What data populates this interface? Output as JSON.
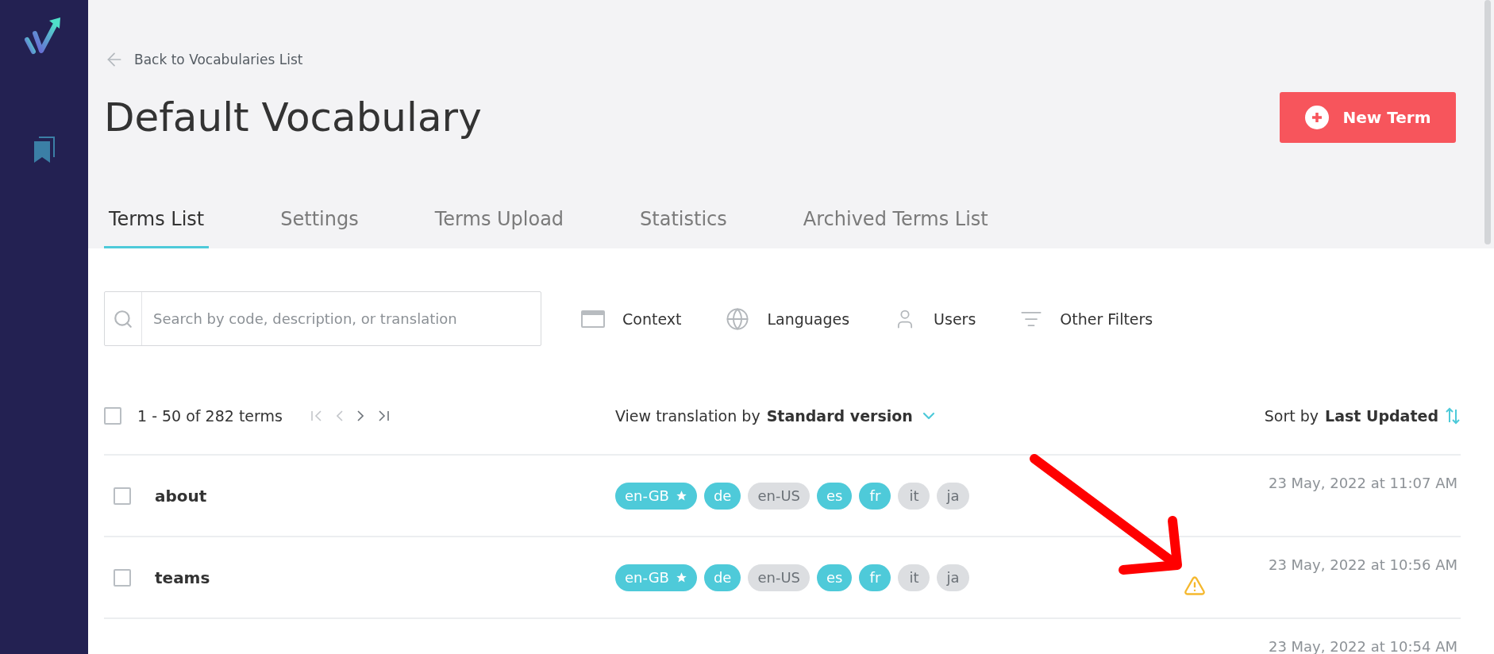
{
  "back_link": "Back to Vocabularies List",
  "title": "Default Vocabulary",
  "new_button": "New Term",
  "tabs": [
    {
      "label": "Terms List",
      "selected": true
    },
    {
      "label": "Settings",
      "selected": false
    },
    {
      "label": "Terms Upload",
      "selected": false
    },
    {
      "label": "Statistics",
      "selected": false
    },
    {
      "label": "Archived Terms List",
      "selected": false
    }
  ],
  "search": {
    "placeholder": "Search by code, description, or translation"
  },
  "filters": [
    {
      "kind": "context",
      "label": "Context"
    },
    {
      "kind": "languages",
      "label": "Languages"
    },
    {
      "kind": "users",
      "label": "Users"
    },
    {
      "kind": "other",
      "label": "Other Filters"
    }
  ],
  "list_header": {
    "select_all_checked": false,
    "range": "1 - 50 of 282 terms",
    "pager": [
      {
        "kind": "first",
        "disabled": true
      },
      {
        "kind": "prev",
        "disabled": true
      },
      {
        "kind": "next",
        "disabled": false
      },
      {
        "kind": "last",
        "disabled": false
      }
    ],
    "view_by_prefix": "View translation by",
    "view_by_value": "Standard version",
    "sort_prefix": "Sort by",
    "sort_value": "Last Updated"
  },
  "rows": [
    {
      "term": "about",
      "checked": false,
      "warning": false,
      "updated": "23 May, 2022 at 11:07 AM",
      "tags": [
        {
          "label": "en-GB",
          "translated": true,
          "primary": true
        },
        {
          "label": "de",
          "translated": true,
          "primary": false
        },
        {
          "label": "en-US",
          "translated": false,
          "primary": false
        },
        {
          "label": "es",
          "translated": true,
          "primary": false
        },
        {
          "label": "fr",
          "translated": true,
          "primary": false
        },
        {
          "label": "it",
          "translated": false,
          "primary": false
        },
        {
          "label": "ja",
          "translated": false,
          "primary": false
        }
      ]
    },
    {
      "term": "teams",
      "checked": false,
      "warning": true,
      "updated": "23 May, 2022 at 10:56 AM",
      "tags": [
        {
          "label": "en-GB",
          "translated": true,
          "primary": true
        },
        {
          "label": "de",
          "translated": true,
          "primary": false
        },
        {
          "label": "en-US",
          "translated": false,
          "primary": false
        },
        {
          "label": "es",
          "translated": true,
          "primary": false
        },
        {
          "label": "fr",
          "translated": true,
          "primary": false
        },
        {
          "label": "it",
          "translated": false,
          "primary": false
        },
        {
          "label": "ja",
          "translated": false,
          "primary": false
        }
      ]
    },
    {
      "warning": false,
      "updated": "23 May, 2022 at 10:54 AM"
    }
  ]
}
